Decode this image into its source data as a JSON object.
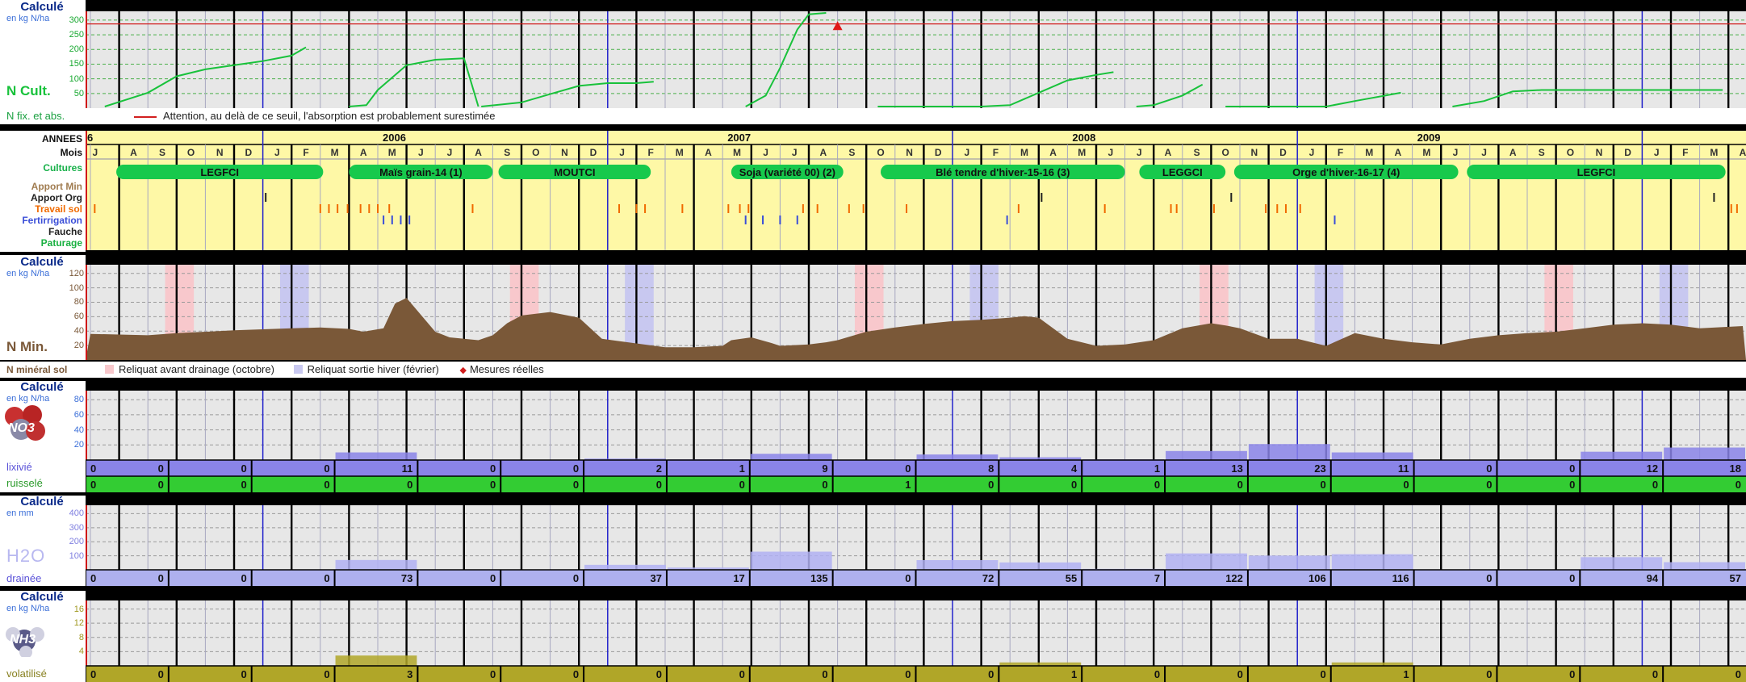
{
  "colors": {
    "panel": "#e7e7e7",
    "calendar": "#fef8a6",
    "crop": "#17c94c",
    "ncult": "#18c23b",
    "nmin": "#7a5838",
    "nitrate": "#8a84e8",
    "ruisselle": "#33cc33",
    "water": "#b0b0f2",
    "nh3": "#b0a628",
    "reliquat_oct": "#f8c8cc",
    "reliquat_fev": "#c8c8f0"
  },
  "ncult": {
    "calcule": "Calculé",
    "unit": "en kg N/ha",
    "title": "N Cult.",
    "ticks": [
      "300",
      "250",
      "200",
      "150",
      "100",
      "50"
    ],
    "fix_label": "N fix. et abs.",
    "seuil_text": "Attention, au delà de ce seuil, l'absorption est probablement surestimée"
  },
  "calendar": {
    "row_labels": [
      "ANNEES",
      "Mois",
      "Cultures",
      "Apport Min",
      "Apport Org",
      "Travail sol",
      "Fertirrigation",
      "Fauche",
      "Paturage"
    ],
    "years": [
      {
        "label": "6",
        "m": 0
      },
      {
        "label": "2006",
        "m": 10
      },
      {
        "label": "2007",
        "m": 22
      },
      {
        "label": "2008",
        "m": 34
      },
      {
        "label": "2009",
        "m": 46
      }
    ],
    "months": [
      "J",
      "A",
      "S",
      "O",
      "N",
      "D",
      "J",
      "F",
      "M",
      "A",
      "M",
      "J",
      "J",
      "A",
      "S",
      "O",
      "N",
      "D",
      "J",
      "F",
      "M",
      "A",
      "M",
      "J",
      "J",
      "A",
      "S",
      "O",
      "N",
      "D",
      "J",
      "F",
      "M",
      "A",
      "M",
      "J",
      "J",
      "A",
      "S",
      "O",
      "N",
      "D",
      "J",
      "F",
      "M",
      "A",
      "M",
      "J",
      "J",
      "A",
      "S",
      "O",
      "N",
      "D",
      "J",
      "F",
      "M",
      "A"
    ],
    "crops": [
      {
        "label": "LEGFCI",
        "s": 0.9,
        "e": 8.1
      },
      {
        "label": "Maïs grain-14 (1)",
        "s": 9.0,
        "e": 14.0
      },
      {
        "label": "MOUTCI",
        "s": 14.2,
        "e": 19.5
      },
      {
        "label": "Soja (variété 00) (2)",
        "s": 22.3,
        "e": 26.2
      },
      {
        "label": "Blé tendre d'hiver-15-16 (3)",
        "s": 27.5,
        "e": 36.0
      },
      {
        "label": "LEGGCI",
        "s": 36.5,
        "e": 39.5
      },
      {
        "label": "Orge d'hiver-16-17 (4)",
        "s": 39.8,
        "e": 47.6
      },
      {
        "label": "LEGFCI",
        "s": 47.9,
        "e": 56.9
      }
    ]
  },
  "nmin": {
    "calcule": "Calculé",
    "unit": "en kg N/ha",
    "title": "N Min.",
    "ticks": [
      "120",
      "100",
      "80",
      "60",
      "40",
      "20"
    ],
    "strip_label": "N minéral sol",
    "legend": [
      "Reliquat avant drainage (octobre)",
      "Reliquat sortie hiver (février)",
      "Mesures réelles"
    ]
  },
  "no3": {
    "calcule": "Calculé",
    "unit": "en kg N/ha",
    "formula": "NO3",
    "ticks": [
      "80",
      "60",
      "40",
      "20"
    ],
    "lixivie_label": "lixivié",
    "ruissele_label": "ruisselé",
    "lixivie": [
      "0",
      "0",
      "0",
      "11",
      "0",
      "0",
      "2",
      "1",
      "9",
      "0",
      "8",
      "4",
      "1",
      "13",
      "23",
      "11",
      "0",
      "0",
      "12",
      "18"
    ],
    "ruissele": [
      "0",
      "0",
      "0",
      "0",
      "0",
      "0",
      "0",
      "0",
      "0",
      "1",
      "0",
      "0",
      "0",
      "0",
      "0",
      "0",
      "0",
      "0",
      "0",
      "0"
    ]
  },
  "h2o": {
    "calcule": "Calculé",
    "unit": "en mm",
    "formula": "H2O",
    "ticks": [
      "400",
      "300",
      "200",
      "100"
    ],
    "draine_label": "drainée",
    "draine": [
      "0",
      "0",
      "0",
      "73",
      "0",
      "0",
      "37",
      "17",
      "135",
      "0",
      "72",
      "55",
      "7",
      "122",
      "106",
      "116",
      "0",
      "0",
      "94",
      "57"
    ]
  },
  "nh3": {
    "calcule": "Calculé",
    "unit": "en kg N/ha",
    "formula": "NH3",
    "ticks": [
      "16",
      "12",
      "8",
      "4"
    ],
    "volat_label": "volatilisé",
    "volat": [
      "0",
      "0",
      "0",
      "3",
      "0",
      "0",
      "0",
      "0",
      "0",
      "0",
      "0",
      "1",
      "0",
      "0",
      "0",
      "1",
      "0",
      "0",
      "0",
      "0"
    ]
  },
  "chart_data": [
    {
      "type": "line",
      "title": "N Cult.",
      "ylabel": "en kg N/ha",
      "ylim": [
        0,
        340
      ],
      "threshold": 300,
      "series": [
        {
          "x": [
            0.5,
            2,
            3,
            4,
            5,
            6,
            7,
            7.5
          ],
          "y": [
            0,
            50,
            110,
            135,
            150,
            165,
            185,
            215
          ]
        },
        {
          "x": [
            9,
            9.6,
            10,
            11,
            12,
            13,
            13.5
          ],
          "y": [
            0,
            5,
            60,
            150,
            170,
            175,
            0
          ]
        },
        {
          "x": [
            13.6,
            15,
            16,
            17,
            18,
            19,
            19.6
          ],
          "y": [
            0,
            15,
            45,
            75,
            85,
            85,
            90
          ]
        },
        {
          "x": [
            22.8,
            23.5,
            24,
            24.6,
            25,
            25.6
          ],
          "y": [
            0,
            40,
            140,
            280,
            335,
            340
          ]
        },
        {
          "x": [
            27.4,
            31,
            32,
            33,
            34,
            35,
            35.6
          ],
          "y": [
            0,
            0,
            5,
            50,
            95,
            115,
            125
          ]
        },
        {
          "x": [
            36.4,
            37,
            38,
            38.7
          ],
          "y": [
            0,
            5,
            40,
            80
          ]
        },
        {
          "x": [
            39.5,
            43,
            44,
            45.6
          ],
          "y": [
            0,
            0,
            20,
            50
          ]
        },
        {
          "x": [
            47.4,
            48.5,
            49.5,
            50.5,
            56.8
          ],
          "y": [
            0,
            20,
            55,
            60,
            60
          ]
        }
      ]
    },
    {
      "type": "area",
      "title": "N Min.",
      "ylabel": "en kg N/ha",
      "ylim": [
        0,
        135
      ],
      "x": [
        0,
        2,
        3,
        5,
        7,
        8,
        9,
        9.5,
        10.2,
        10.6,
        11,
        12,
        12.5,
        13.5,
        14,
        14.5,
        15,
        16,
        17,
        17.8,
        20,
        21,
        22,
        22.3,
        23,
        23.7,
        24,
        25,
        25.6,
        26,
        27,
        28,
        29,
        30,
        31,
        32,
        32.5,
        33,
        34,
        35,
        36,
        37,
        38,
        39,
        39.5,
        40,
        41,
        42,
        43,
        44,
        45,
        46,
        47,
        48,
        49,
        50,
        51,
        52,
        53,
        54,
        55,
        56,
        57.5
      ],
      "y": [
        37,
        35,
        38,
        42,
        45,
        46,
        44,
        40,
        45,
        80,
        88,
        40,
        32,
        28,
        35,
        52,
        63,
        68,
        60,
        30,
        18,
        18,
        20,
        28,
        32,
        24,
        20,
        22,
        25,
        28,
        40,
        46,
        51,
        55,
        57,
        60,
        62,
        60,
        30,
        20,
        22,
        28,
        45,
        52,
        49,
        45,
        30,
        30,
        20,
        38,
        30,
        25,
        22,
        30,
        35,
        38,
        40,
        45,
        50,
        52,
        50,
        45,
        48
      ]
    },
    {
      "type": "bar",
      "title": "NO3",
      "ylabel": "en kg N/ha",
      "ylim": [
        0,
        100
      ],
      "series": [
        {
          "name": "lixivié",
          "values": [
            0,
            0,
            0,
            11,
            0,
            0,
            2,
            1,
            9,
            0,
            8,
            4,
            1,
            13,
            23,
            11,
            0,
            0,
            12,
            18
          ]
        },
        {
          "name": "ruisselé",
          "values": [
            0,
            0,
            0,
            0,
            0,
            0,
            0,
            0,
            0,
            1,
            0,
            0,
            0,
            0,
            0,
            0,
            0,
            0,
            0,
            0
          ]
        }
      ]
    },
    {
      "type": "bar",
      "title": "H2O",
      "ylabel": "en mm",
      "ylim": [
        0,
        480
      ],
      "series": [
        {
          "name": "drainée",
          "values": [
            0,
            0,
            0,
            73,
            0,
            0,
            37,
            17,
            135,
            0,
            72,
            55,
            7,
            122,
            106,
            116,
            0,
            0,
            94,
            57
          ]
        }
      ]
    },
    {
      "type": "bar",
      "title": "NH3",
      "ylabel": "en kg N/ha",
      "ylim": [
        0,
        19
      ],
      "series": [
        {
          "name": "volatilisé",
          "values": [
            0,
            0,
            0,
            3,
            0,
            0,
            0,
            0,
            0,
            0,
            0,
            1,
            0,
            0,
            0,
            1,
            0,
            0,
            0,
            0
          ]
        }
      ]
    }
  ]
}
